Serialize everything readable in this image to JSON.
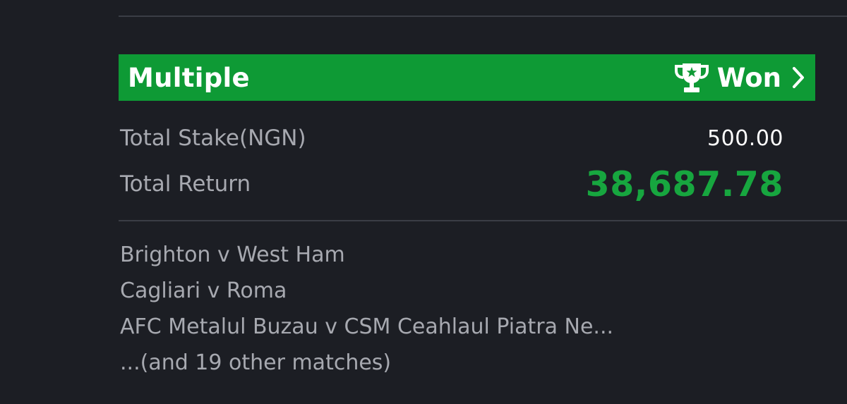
{
  "bet": {
    "type_label": "Multiple",
    "status_label": "Won",
    "status_icon": "trophy-icon",
    "action_icon": "chevron-right-icon",
    "banner_color": "#0e9a35"
  },
  "summary": {
    "stake_label": "Total Stake(NGN)",
    "stake_value": "500.00",
    "return_label": "Total Return",
    "return_value": "38,687.78",
    "return_color": "#17a63f"
  },
  "matches": [
    "Brighton v West Ham",
    "Cagliari v Roma",
    "AFC Metalul Buzau v CSM Ceahlaul Piatra Ne...",
    "...(and 19 other matches)"
  ]
}
